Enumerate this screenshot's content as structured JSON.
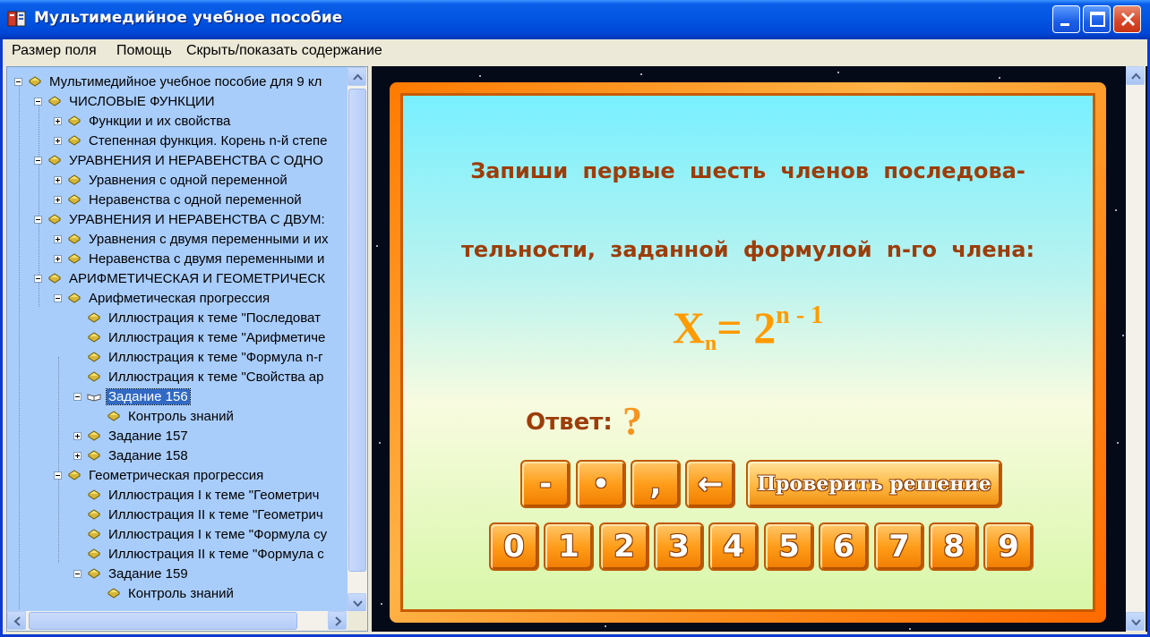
{
  "window": {
    "title": "Мультимедийное учебное пособие",
    "titlebar_color": "#0054e3",
    "controls": {
      "minimize": "minimize-icon",
      "maximize": "maximize-icon",
      "close": "close-icon"
    }
  },
  "menu": {
    "items": [
      "Размер поля",
      "Помощь",
      "Скрыть/показать содержание"
    ]
  },
  "tree": {
    "background": "#a9cdfb",
    "nodes": [
      {
        "label": "Мультимедийное учебное пособие для 9 кл",
        "level": 0,
        "expander": "minus",
        "icon": "closed-book-icon"
      },
      {
        "label": "ЧИСЛОВЫЕ ФУНКЦИИ",
        "level": 1,
        "expander": "minus",
        "icon": "closed-book-icon"
      },
      {
        "label": "Функции и их свойства",
        "level": 2,
        "expander": "plus",
        "icon": "closed-book-icon"
      },
      {
        "label": "Степенная функция. Корень n-й степе",
        "level": 2,
        "expander": "plus",
        "icon": "closed-book-icon"
      },
      {
        "label": "УРАВНЕНИЯ И НЕРАВЕНСТВА С ОДНО",
        "level": 1,
        "expander": "minus",
        "icon": "closed-book-icon"
      },
      {
        "label": "Уравнения с одной переменной",
        "level": 2,
        "expander": "plus",
        "icon": "closed-book-icon"
      },
      {
        "label": "Неравенства с одной переменной",
        "level": 2,
        "expander": "plus",
        "icon": "closed-book-icon"
      },
      {
        "label": "УРАВНЕНИЯ И НЕРАВЕНСТВА С ДВУМ:",
        "level": 1,
        "expander": "minus",
        "icon": "closed-book-icon"
      },
      {
        "label": "Уравнения с двумя переменными и их",
        "level": 2,
        "expander": "plus",
        "icon": "closed-book-icon"
      },
      {
        "label": "Неравенства с двумя переменными и",
        "level": 2,
        "expander": "plus",
        "icon": "closed-book-icon"
      },
      {
        "label": "АРИФМЕТИЧЕСКАЯ И ГЕОМЕТРИЧЕСК",
        "level": 1,
        "expander": "minus",
        "icon": "closed-book-icon"
      },
      {
        "label": "Арифметическая прогрессия",
        "level": 2,
        "expander": "minus",
        "icon": "closed-book-icon"
      },
      {
        "label": "Иллюстрация к теме \"Последоват",
        "level": 3,
        "expander": "none",
        "icon": "closed-book-icon"
      },
      {
        "label": "Иллюстрация к теме \"Арифметиче",
        "level": 3,
        "expander": "none",
        "icon": "closed-book-icon"
      },
      {
        "label": "Иллюстрация к теме \"Формула n-г",
        "level": 3,
        "expander": "none",
        "icon": "closed-book-icon"
      },
      {
        "label": "Иллюстрация к теме \"Свойства ар",
        "level": 3,
        "expander": "none",
        "icon": "closed-book-icon"
      },
      {
        "label": "Задание 156",
        "level": 3,
        "expander": "minus",
        "icon": "open-book-icon",
        "selected": true
      },
      {
        "label": "Контроль знаний",
        "level": 4,
        "expander": "none",
        "icon": "closed-book-icon"
      },
      {
        "label": "Задание 157",
        "level": 3,
        "expander": "plus",
        "icon": "closed-book-icon"
      },
      {
        "label": "Задание 158",
        "level": 3,
        "expander": "plus",
        "icon": "closed-book-icon"
      },
      {
        "label": "Геометрическая прогрессия",
        "level": 2,
        "expander": "minus",
        "icon": "closed-book-icon"
      },
      {
        "label": "Иллюстрация I к теме \"Геометрич",
        "level": 3,
        "expander": "none",
        "icon": "closed-book-icon"
      },
      {
        "label": "Иллюстрация II к теме \"Геометрич",
        "level": 3,
        "expander": "none",
        "icon": "closed-book-icon"
      },
      {
        "label": "Иллюстрация I к теме \"Формула су",
        "level": 3,
        "expander": "none",
        "icon": "closed-book-icon"
      },
      {
        "label": "Иллюстрация II к теме \"Формула с",
        "level": 3,
        "expander": "none",
        "icon": "closed-book-icon"
      },
      {
        "label": "Задание 159",
        "level": 3,
        "expander": "minus",
        "icon": "closed-book-icon"
      },
      {
        "label": "Контроль знаний",
        "level": 4,
        "expander": "none",
        "icon": "closed-book-icon"
      }
    ]
  },
  "slide": {
    "task_line1": "Запиши первые шесть членов последова-",
    "task_line2": "тельности, заданной формулой n-го члена:",
    "formula": {
      "base": "X",
      "subscript": "n",
      "equals": "= 2",
      "exponent": "n - 1"
    },
    "answer_label": "Ответ:",
    "answer_value": "?",
    "symbol_keys": [
      "-",
      "•",
      ",",
      "←"
    ],
    "check_button": "Проверить решение",
    "digit_keys": [
      "0",
      "1",
      "2",
      "3",
      "4",
      "5",
      "6",
      "7",
      "8",
      "9"
    ],
    "colors": {
      "frame": "#ff8c1a",
      "text": "#9c3d0a",
      "formula": "#ff9a00",
      "key": "#ff9d1a"
    }
  }
}
